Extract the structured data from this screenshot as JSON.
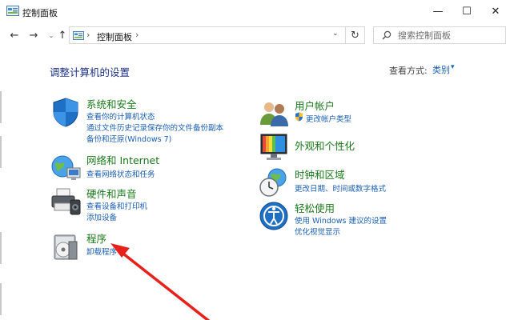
{
  "window": {
    "title": "控制面板",
    "minimize": "—",
    "maximize": "☐",
    "close": "✕"
  },
  "nav": {
    "back": "←",
    "forward": "→",
    "recent": "⌄",
    "up": "↑",
    "address_sep": "›",
    "address_crumb": "控制面板",
    "address_dropdown": "⌄",
    "refresh": "↻",
    "search_placeholder": "搜索控制面板"
  },
  "content": {
    "heading": "调整计算机的设置",
    "view_by_label": "查看方式:",
    "view_by_value": "类别",
    "view_by_caret": "▾"
  },
  "categories_left": [
    {
      "title": "系统和安全",
      "links": [
        "查看你的计算机状态",
        "通过文件历史记录保存你的文件备份副本",
        "备份和还原(Windows 7)"
      ]
    },
    {
      "title": "网络和 Internet",
      "links": [
        "查看网络状态和任务"
      ]
    },
    {
      "title": "硬件和声音",
      "links": [
        "查看设备和打印机",
        "添加设备"
      ]
    },
    {
      "title": "程序",
      "links": [
        "卸载程序"
      ]
    }
  ],
  "categories_right": [
    {
      "title": "用户帐户",
      "links": [
        "更改帐户类型"
      ]
    },
    {
      "title": "外观和个性化",
      "links": []
    },
    {
      "title": "时钟和区域",
      "links": [
        "更改日期、时间或数字格式"
      ]
    },
    {
      "title": "轻松使用",
      "links": [
        "使用 Windows 建议的设置",
        "优化视觉显示"
      ]
    }
  ],
  "colors": {
    "heading": "#1e3287",
    "category_title": "#1a7a1a",
    "link": "#1a5fb4",
    "annotation_arrow": "#e8201a"
  },
  "icons": {
    "system_security": "shield-icon",
    "network": "globe-network-icon",
    "hardware": "printer-icon",
    "programs": "programs-disc-icon",
    "user_accounts": "users-icon",
    "appearance": "monitor-icon",
    "clock_region": "clock-globe-icon",
    "ease_of_access": "accessibility-icon"
  }
}
